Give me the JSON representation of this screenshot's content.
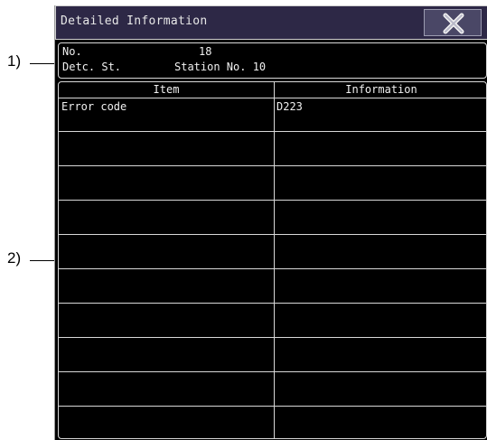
{
  "callouts": {
    "one": "1)",
    "two": "2)"
  },
  "window": {
    "title": "Detailed Information",
    "close_icon": "close-x-icon"
  },
  "status": {
    "no_label": "No.",
    "no_value": "18",
    "detc_label": "Detc. St.",
    "detc_value": "Station No. 10"
  },
  "table": {
    "headers": [
      "Item",
      "Information"
    ],
    "rows": [
      {
        "item": "Error code",
        "info": "D223"
      },
      {
        "item": "",
        "info": ""
      },
      {
        "item": "",
        "info": ""
      },
      {
        "item": "",
        "info": ""
      },
      {
        "item": "",
        "info": ""
      },
      {
        "item": "",
        "info": ""
      },
      {
        "item": "",
        "info": ""
      },
      {
        "item": "",
        "info": ""
      },
      {
        "item": "",
        "info": ""
      },
      {
        "item": "",
        "info": ""
      }
    ]
  },
  "colors": {
    "titlebar": "#2d2846",
    "background": "#000000",
    "border": "#d8d8d8",
    "close_button": "#4a4766"
  }
}
